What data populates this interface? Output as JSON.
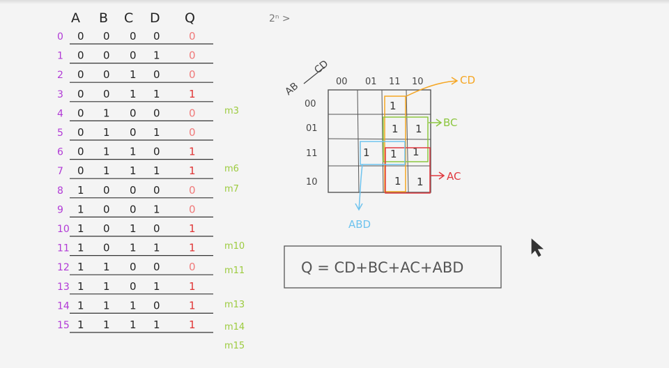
{
  "truth_table": {
    "headers": [
      "A",
      "B",
      "C",
      "D",
      "Q"
    ],
    "rows": [
      {
        "index": "0",
        "a": "0",
        "b": "0",
        "c": "0",
        "d": "0",
        "q": "0"
      },
      {
        "index": "1",
        "a": "0",
        "b": "0",
        "c": "0",
        "d": "1",
        "q": "0"
      },
      {
        "index": "2",
        "a": "0",
        "b": "0",
        "c": "1",
        "d": "0",
        "q": "0"
      },
      {
        "index": "3",
        "a": "0",
        "b": "0",
        "c": "1",
        "d": "1",
        "q": "1"
      },
      {
        "index": "4",
        "a": "0",
        "b": "1",
        "c": "0",
        "d": "0",
        "q": "0"
      },
      {
        "index": "5",
        "a": "0",
        "b": "1",
        "c": "0",
        "d": "1",
        "q": "0"
      },
      {
        "index": "6",
        "a": "0",
        "b": "1",
        "c": "1",
        "d": "0",
        "q": "1"
      },
      {
        "index": "7",
        "a": "0",
        "b": "1",
        "c": "1",
        "d": "1",
        "q": "1"
      },
      {
        "index": "8",
        "a": "1",
        "b": "0",
        "c": "0",
        "d": "0",
        "q": "0"
      },
      {
        "index": "9",
        "a": "1",
        "b": "0",
        "c": "0",
        "d": "1",
        "q": "0"
      },
      {
        "index": "10",
        "a": "1",
        "b": "0",
        "c": "1",
        "d": "0",
        "q": "1"
      },
      {
        "index": "11",
        "a": "1",
        "b": "0",
        "c": "1",
        "d": "1",
        "q": "1"
      },
      {
        "index": "12",
        "a": "1",
        "b": "1",
        "c": "0",
        "d": "0",
        "q": "0"
      },
      {
        "index": "13",
        "a": "1",
        "b": "1",
        "c": "0",
        "d": "1",
        "q": "1"
      },
      {
        "index": "14",
        "a": "1",
        "b": "1",
        "c": "1",
        "d": "0",
        "q": "1"
      },
      {
        "index": "15",
        "a": "1",
        "b": "1",
        "c": "1",
        "d": "1",
        "q": "1"
      }
    ],
    "minterms": [
      "m3",
      "m6",
      "m7",
      "m10",
      "m11",
      "m13",
      "m14",
      "m15"
    ]
  },
  "top_note": "2ⁿ >",
  "kmap": {
    "corner_row_label": "AB",
    "corner_col_label": "CD",
    "col_labels": [
      "00",
      "01",
      "11",
      "10"
    ],
    "row_labels": [
      "00",
      "01",
      "11",
      "10"
    ],
    "ones": [
      "1",
      "1",
      "1",
      "1",
      "1",
      "1",
      "1",
      "1"
    ],
    "group_labels": {
      "cd": "CD",
      "bc": "BC",
      "ac": "AC",
      "abd": "ABD"
    }
  },
  "equation": "Q = CD+BC+AC+ABD",
  "colors": {
    "ink": "#222222",
    "index": "#b13ad6",
    "q_zero": "#f07a7a",
    "q_one": "#e03434",
    "minterm": "#9ccb3e",
    "group_cd": "#f5a623",
    "group_bc": "#8cc63f",
    "group_ac": "#e0383e",
    "group_abd": "#6ec3ee",
    "equation": "#555555"
  }
}
